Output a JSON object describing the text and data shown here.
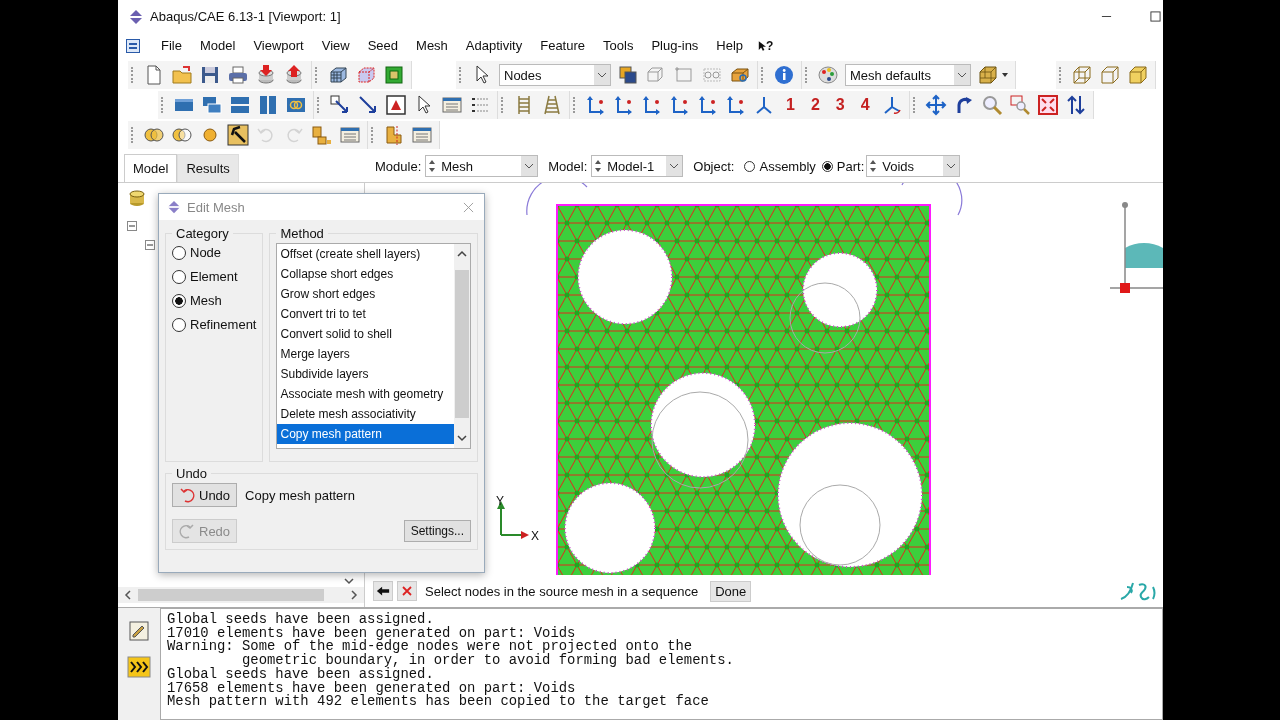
{
  "window": {
    "title": "Abaqus/CAE 6.13-1 [Viewport: 1]"
  },
  "menu": {
    "items": [
      "File",
      "Model",
      "Viewport",
      "View",
      "Seed",
      "Mesh",
      "Adaptivity",
      "Feature",
      "Tools",
      "Plug-ins",
      "Help"
    ],
    "context_help": "?"
  },
  "toolbar": {
    "selection_filter": "Nodes",
    "render_style": "Mesh defaults",
    "view_numbers": [
      "1",
      "2",
      "3",
      "4"
    ]
  },
  "tabs": [
    {
      "label": "Model",
      "selected": true
    },
    {
      "label": "Results",
      "selected": false
    }
  ],
  "context_bar": {
    "module_label": "Module:",
    "module": "Mesh",
    "model_label": "Model:",
    "model": "Model-1",
    "object_label": "Object:",
    "objects": [
      {
        "label": "Assembly",
        "selected": false
      },
      {
        "label": "Part:",
        "selected": true
      }
    ],
    "part": "Voids"
  },
  "dialog": {
    "title": "Edit Mesh",
    "category_title": "Category",
    "categories": [
      {
        "label": "Node",
        "selected": false
      },
      {
        "label": "Element",
        "selected": false
      },
      {
        "label": "Mesh",
        "selected": true
      },
      {
        "label": "Refinement",
        "selected": false
      }
    ],
    "method_title": "Method",
    "methods": [
      {
        "label": "Offset (create shell layers)",
        "selected": false
      },
      {
        "label": "Collapse short edges",
        "selected": false
      },
      {
        "label": "Grow short edges",
        "selected": false
      },
      {
        "label": "Convert tri to tet",
        "selected": false
      },
      {
        "label": "Convert solid to shell",
        "selected": false
      },
      {
        "label": "Merge layers",
        "selected": false
      },
      {
        "label": "Subdivide layers",
        "selected": false
      },
      {
        "label": "Associate mesh with geometry",
        "selected": false
      },
      {
        "label": "Delete mesh associativity",
        "selected": false
      },
      {
        "label": "Copy mesh pattern",
        "selected": true
      }
    ],
    "undo_title": "Undo",
    "undo_button": "Undo",
    "undo_action": "Copy mesh pattern",
    "redo_button": {
      "label": "Redo",
      "disabled": true
    },
    "settings_button": "Settings..."
  },
  "viewport": {
    "triad": {
      "y": "Y",
      "x": "X"
    }
  },
  "prompt": {
    "text": "Select nodes in the source mesh in a sequence",
    "done": "Done"
  },
  "messages": [
    "Global seeds have been assigned.",
    "17010 elements have been generated on part: Voids",
    "Warning: Some of the mid-edge nodes were not projected onto the",
    "         geometric boundary, in order to avoid forming bad elements.",
    "Global seeds have been assigned.",
    "17658 elements have been generated on part: Voids",
    "Mesh pattern with 492 elements has been copied to the target face"
  ]
}
